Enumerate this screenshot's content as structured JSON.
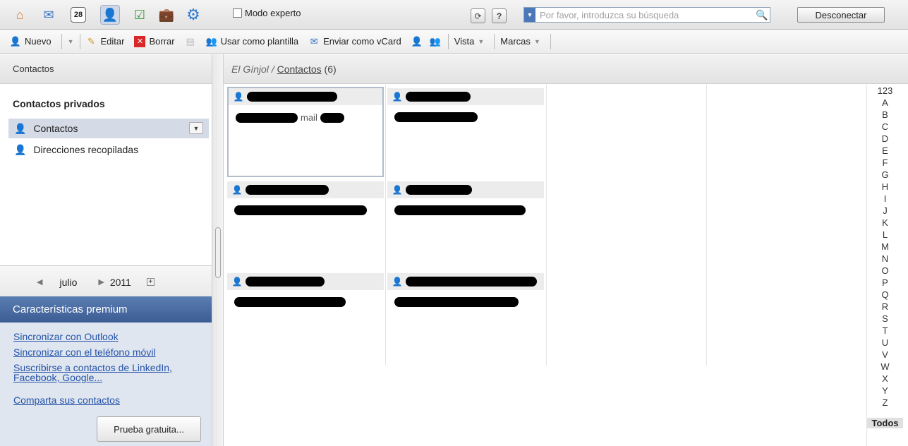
{
  "topbar": {
    "apps": [
      {
        "icon": "home-icon",
        "glyph": "⌂"
      },
      {
        "icon": "mail-icon",
        "glyph": "✉"
      },
      {
        "icon": "calendar-icon",
        "glyph": "28"
      },
      {
        "icon": "contacts-icon",
        "glyph": "👤"
      },
      {
        "icon": "tasks-icon",
        "glyph": "☑"
      },
      {
        "icon": "files-icon",
        "glyph": "💼"
      },
      {
        "icon": "settings-icon",
        "glyph": "⚙"
      }
    ],
    "expert_mode_label": "Modo experto",
    "search_placeholder": "Por favor, introduzca su búsqueda",
    "logout_label": "Desconectar"
  },
  "toolbar": {
    "new_label": "Nuevo",
    "edit_label": "Editar",
    "delete_label": "Borrar",
    "template_label": "Usar como plantilla",
    "vcard_label": "Enviar como vCard",
    "view_label": "Vista",
    "tags_label": "Marcas"
  },
  "left": {
    "header": "Contactos",
    "folders_title": "Contactos privados",
    "folders": [
      {
        "label": "Contactos",
        "selected": true
      },
      {
        "label": "Direcciones recopiladas",
        "selected": false
      }
    ],
    "calendar": {
      "month": "julio",
      "year": "2011"
    },
    "premium": {
      "title": "Características premium",
      "links": [
        "Sincronizar con Outlook",
        "Sincronizar con el teléfono móvil",
        "Suscribirse a contactos de LinkedIn, Facebook, Google...",
        "Comparta sus contactos"
      ],
      "trial_label": "Prueba gratuita..."
    }
  },
  "main": {
    "breadcrumb_root": "El Gínjol",
    "breadcrumb_sep": "/",
    "breadcrumb_folder": "Contactos",
    "count": "(6)",
    "cards": [
      {
        "name_suffix": "",
        "email_suffix": "mail",
        "selected": true
      },
      {
        "name_suffix": "",
        "email_suffix": "",
        "selected": false
      },
      {
        "name_suffix": "",
        "email_suffix": "",
        "selected": false
      },
      {
        "name_suffix": "",
        "email_suffix": "",
        "selected": false
      },
      {
        "name_suffix": "",
        "email_suffix": "",
        "selected": false
      },
      {
        "name_suffix": "",
        "email_suffix": "",
        "selected": false
      }
    ]
  },
  "alphabet": [
    "123",
    "A",
    "B",
    "C",
    "D",
    "E",
    "F",
    "G",
    "H",
    "I",
    "J",
    "K",
    "L",
    "M",
    "N",
    "O",
    "P",
    "Q",
    "R",
    "S",
    "T",
    "U",
    "V",
    "W",
    "X",
    "Y",
    "Z"
  ],
  "alphabet_all": "Todos",
  "colors": {
    "premium_header": "#4a6ca3",
    "link": "#2553a8",
    "selection": "#d5dbe6"
  }
}
